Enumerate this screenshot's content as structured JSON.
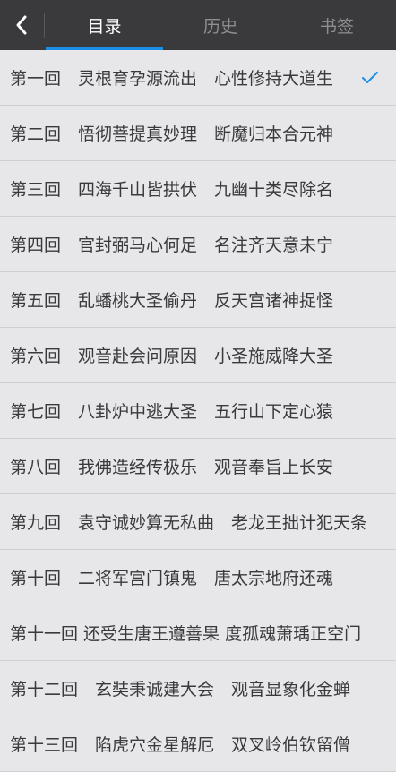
{
  "header": {
    "tabs": [
      "目录",
      "历史",
      "书签"
    ],
    "active_tab": "目录"
  },
  "chapters": [
    "第一回　灵根育孕源流出　心性修持大道生",
    "第二回　悟彻菩提真妙理　断魔归本合元神",
    "第三回　四海千山皆拱伏　九幽十类尽除名",
    "第四回　官封弼马心何足　名注齐天意未宁",
    "第五回　乱蟠桃大圣偷丹　反天宫诸神捉怪",
    "第六回　观音赴会问原因　小圣施威降大圣",
    "第七回　八卦炉中逃大圣　五行山下定心猿",
    "第八回　我佛造经传极乐　观音奉旨上长安",
    "第九回　袁守诚妙算无私曲　老龙王拙计犯天条",
    "第十回　二将军宫门镇鬼　唐太宗地府还魂",
    "第十一回 还受生唐王遵善果 度孤魂萧瑀正空门",
    "第十二回　玄奘秉诚建大会　观音显象化金蝉",
    "第十三回　陷虎穴金星解厄　双叉岭伯钦留僧"
  ],
  "selected_chapter_index": 0,
  "colors": {
    "header_bg": "#3a3a3c",
    "accent": "#1b8fe8",
    "list_bg": "#e7e6e8",
    "text": "#3a3a3c"
  },
  "icons": {
    "back": "chevron-left-icon",
    "selected": "checkmark-icon"
  }
}
